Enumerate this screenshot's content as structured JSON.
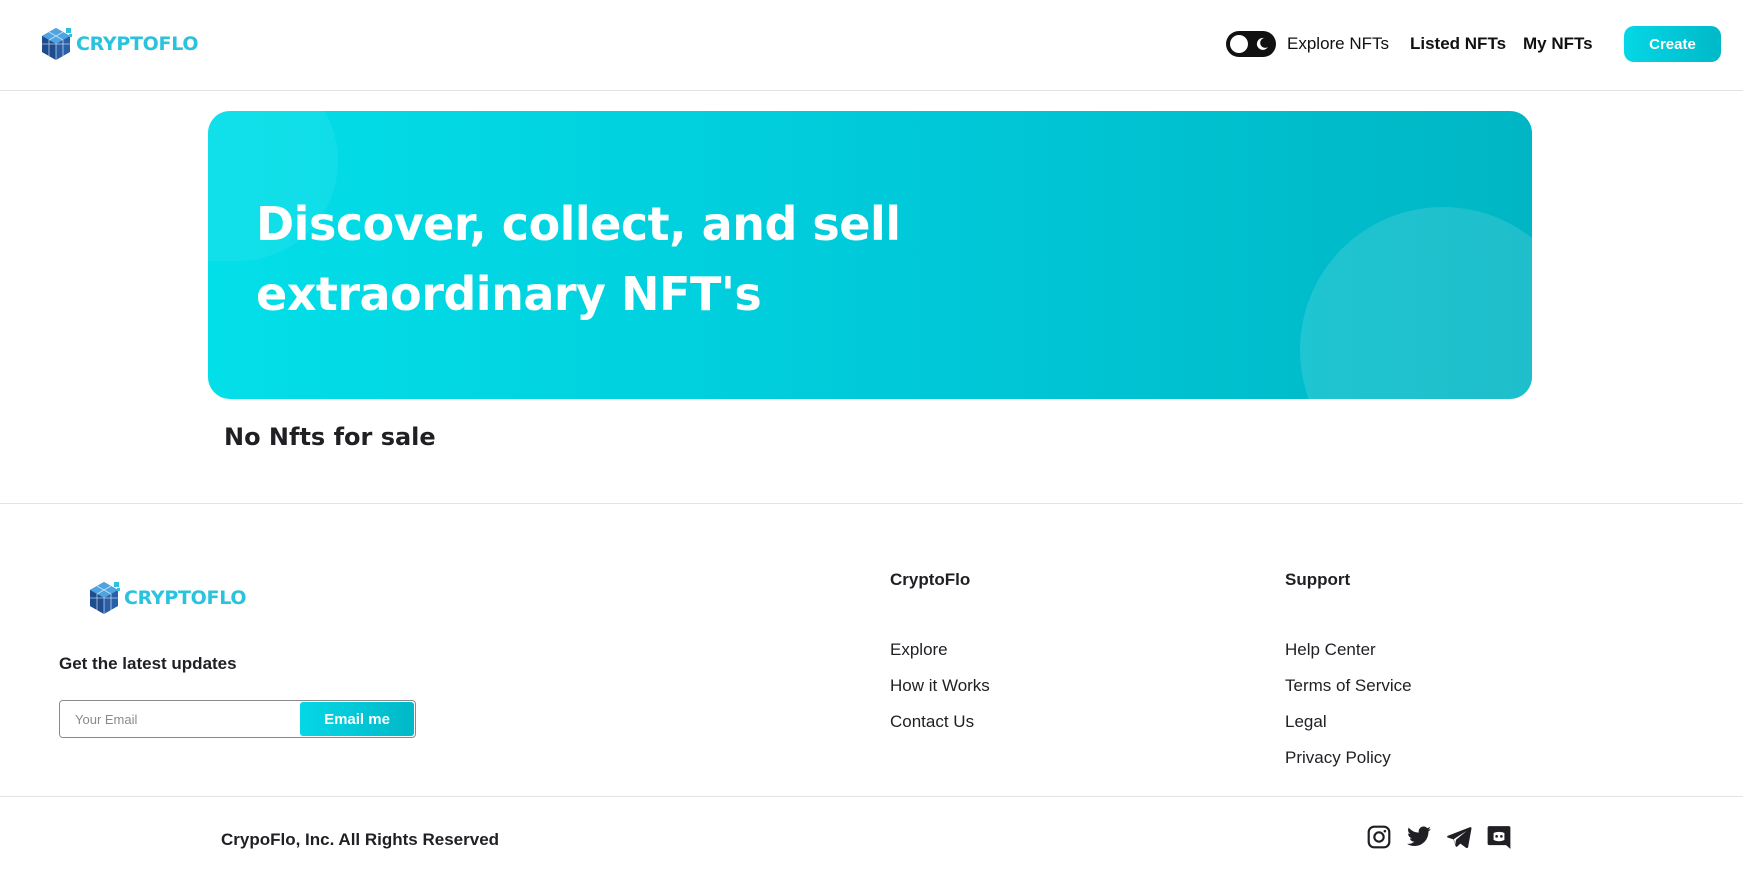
{
  "header": {
    "logo_text": "CRYPTOFLO",
    "nav": [
      "Explore NFTs",
      "Listed NFTs",
      "My NFTs"
    ],
    "create_label": "Create"
  },
  "hero": {
    "title": "Discover, collect, and sell extraordinary NFT's"
  },
  "main": {
    "empty_message": "No Nfts for sale"
  },
  "footer": {
    "logo_text": "CRYPTOFLO",
    "newsletter_heading": "Get the latest updates",
    "email_placeholder": "Your Email",
    "email_button": "Email me",
    "columns": [
      {
        "title": "CryptoFlo",
        "links": [
          "Explore",
          "How it Works",
          "Contact Us"
        ]
      },
      {
        "title": "Support",
        "links": [
          "Help Center",
          "Terms of Service",
          "Legal",
          "Privacy Policy"
        ]
      }
    ],
    "copyright": "CrypoFlo, Inc. All Rights Reserved",
    "social_icons": [
      "instagram-icon",
      "twitter-icon",
      "telegram-icon",
      "discord-icon"
    ]
  },
  "colors": {
    "accent": "#00c8d8",
    "accent_light": "#03dfe9",
    "text": "#1f1f24"
  }
}
